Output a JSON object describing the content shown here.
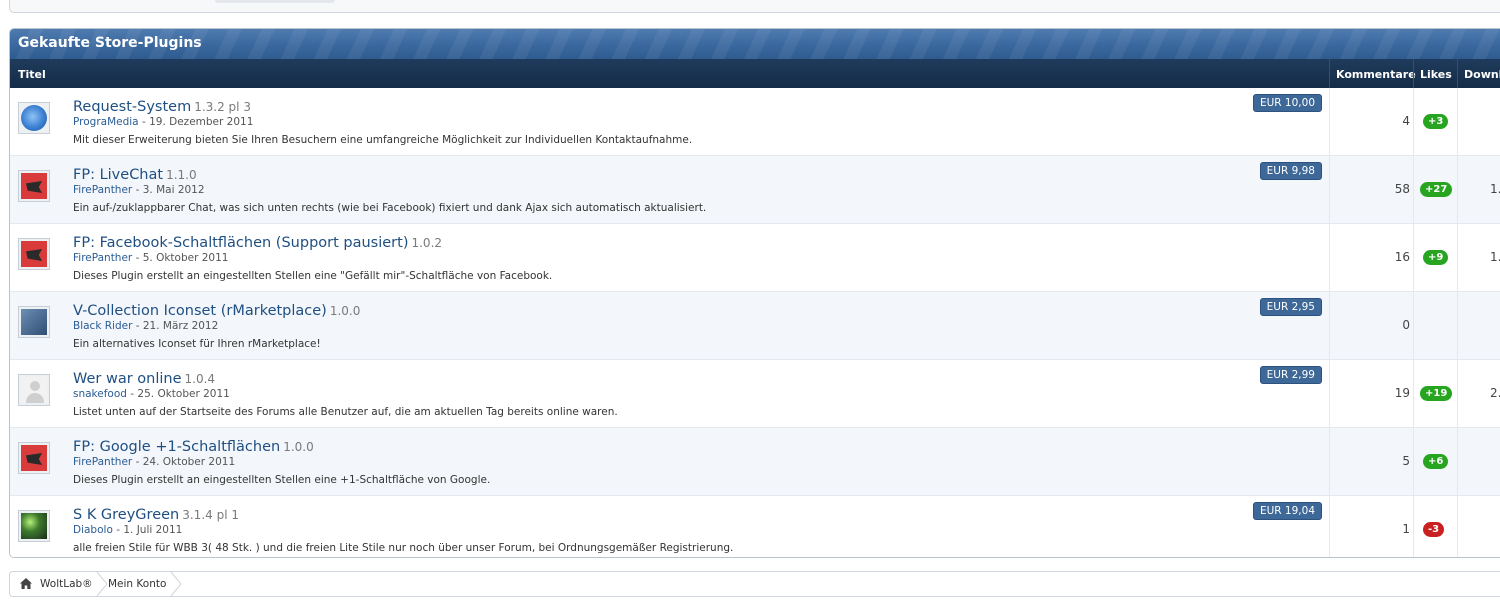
{
  "section": {
    "title": "Gekaufte Store-Plugins"
  },
  "columns": {
    "title": "Titel",
    "comments": "Kommentare",
    "likes": "Likes",
    "downloads": "Downlo"
  },
  "rows": [
    {
      "avatar": "globe-icon",
      "title": "Request-System",
      "version": "1.3.2 pl 3",
      "author": "PrograMedia",
      "date": "- 19. Dezember 2011",
      "description": "Mit dieser Erweiterung bieten Sie Ihren Besuchern eine umfangreiche Möglichkeit zur Individuellen Kontaktaufnahme.",
      "price": "EUR 10,00",
      "comments": "4",
      "likes": "+3",
      "likes_kind": "pos",
      "downloads": ""
    },
    {
      "avatar": "firepanther-icon",
      "title": "FP: LiveChat",
      "version": "1.1.0",
      "author": "FirePanther",
      "date": "- 3. Mai 2012",
      "description": "Ein auf-/zuklappbarer Chat, was sich unten rechts (wie bei Facebook) fixiert und dank Ajax sich automatisch aktualisiert.",
      "price": "EUR 9,98",
      "comments": "58",
      "likes": "+27",
      "likes_kind": "pos",
      "downloads": "1."
    },
    {
      "avatar": "firepanther-icon",
      "title": "FP: Facebook-Schaltflächen (Support pausiert)",
      "version": "1.0.2",
      "author": "FirePanther",
      "date": "- 5. Oktober 2011",
      "description": "Dieses Plugin erstellt an eingestellten Stellen eine \"Gefällt mir\"-Schaltfläche von Facebook.",
      "price": "",
      "comments": "16",
      "likes": "+9",
      "likes_kind": "pos",
      "downloads": "1."
    },
    {
      "avatar": "iconset-icon",
      "title": "V-Collection Iconset (rMarketplace)",
      "version": "1.0.0",
      "author": "Black Rider",
      "date": "- 21. März 2012",
      "description": "Ein alternatives Iconset für Ihren rMarketplace!",
      "price": "EUR 2,95",
      "comments": "0",
      "likes": "",
      "likes_kind": "",
      "downloads": ""
    },
    {
      "avatar": "user-placeholder-icon",
      "title": "Wer war online",
      "version": "1.0.4",
      "author": "snakefood",
      "date": "- 25. Oktober 2011",
      "description": "Listet unten auf der Startseite des Forums alle Benutzer auf, die am aktuellen Tag bereits online waren.",
      "price": "EUR 2,99",
      "comments": "19",
      "likes": "+19",
      "likes_kind": "pos",
      "downloads": "2."
    },
    {
      "avatar": "firepanther-icon",
      "title": "FP: Google +1-Schaltflächen",
      "version": "1.0.0",
      "author": "FirePanther",
      "date": "- 24. Oktober 2011",
      "description": "Dieses Plugin erstellt an eingestellten Stellen eine +1-Schaltfläche von Google.",
      "price": "",
      "comments": "5",
      "likes": "+6",
      "likes_kind": "pos",
      "downloads": ""
    },
    {
      "avatar": "greygreen-icon",
      "title": "S K GreyGreen",
      "version": "3.1.4 pl 1",
      "author": "Diabolo",
      "date": "- 1. Juli 2011",
      "description": "alle freien Stile für WBB 3( 48 Stk. ) und die freien Lite Stile nur noch über unser Forum, bei Ordnungsgemäßer Registrierung.",
      "price": "EUR 19,04",
      "comments": "1",
      "likes": "-3",
      "likes_kind": "neg",
      "downloads": ""
    }
  ],
  "breadcrumb": {
    "home": "WoltLab®",
    "current": "Mein Konto"
  }
}
